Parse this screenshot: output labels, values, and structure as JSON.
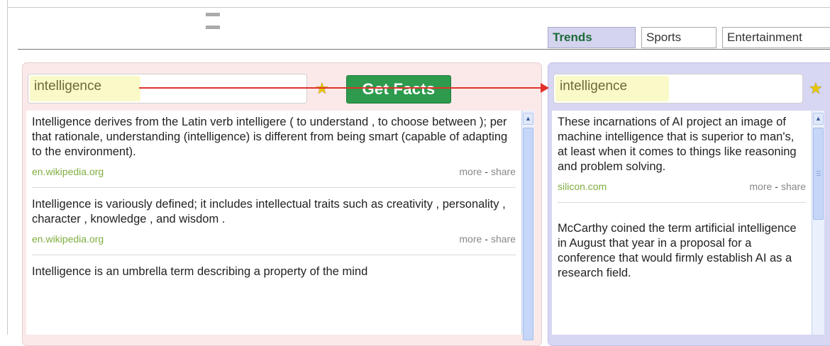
{
  "tabs": [
    {
      "label": "Trends",
      "active": true
    },
    {
      "label": "Sports",
      "active": false
    },
    {
      "label": "Entertainment",
      "active": false
    }
  ],
  "left_panel": {
    "query": "intelligence",
    "button_label": "Get Facts",
    "facts": [
      {
        "text": "Intelligence derives from the Latin verb intelligere ( to understand , to choose between ); per that rationale, understanding (intelligence) is different from being smart (capable of adapting to the environment).",
        "source": "en.wikipedia.org",
        "more": "more",
        "share": "share"
      },
      {
        "text": "Intelligence is variously defined; it includes intellectual traits such as creativity , personality , character , knowledge , and wisdom .",
        "source": "en.wikipedia.org",
        "more": "more",
        "share": "share"
      },
      {
        "text": "Intelligence is an umbrella term describing a property of the mind",
        "source": "",
        "more": "",
        "share": ""
      }
    ]
  },
  "right_panel": {
    "query": "intelligence",
    "facts": [
      {
        "text": "These incarnations of AI project an image of machine intelligence that is superior to man's, at least when it comes to things like reasoning and problem solving.",
        "source": "silicon.com",
        "more": "more",
        "share": "share"
      },
      {
        "text": "McCarthy coined the term artificial intelligence in August that year in a proposal for a conference that would firmly establish AI as a research field.",
        "source": "",
        "more": "",
        "share": ""
      }
    ]
  },
  "colors": {
    "accent_green": "#2d9a4d",
    "arrow_red": "#e0322a",
    "source_green": "#7fae3f",
    "left_panel_bg": "#fbe9ea",
    "right_panel_bg": "#d7d7f3"
  },
  "icons": [
    "star-icon",
    "scroll-up-icon"
  ]
}
